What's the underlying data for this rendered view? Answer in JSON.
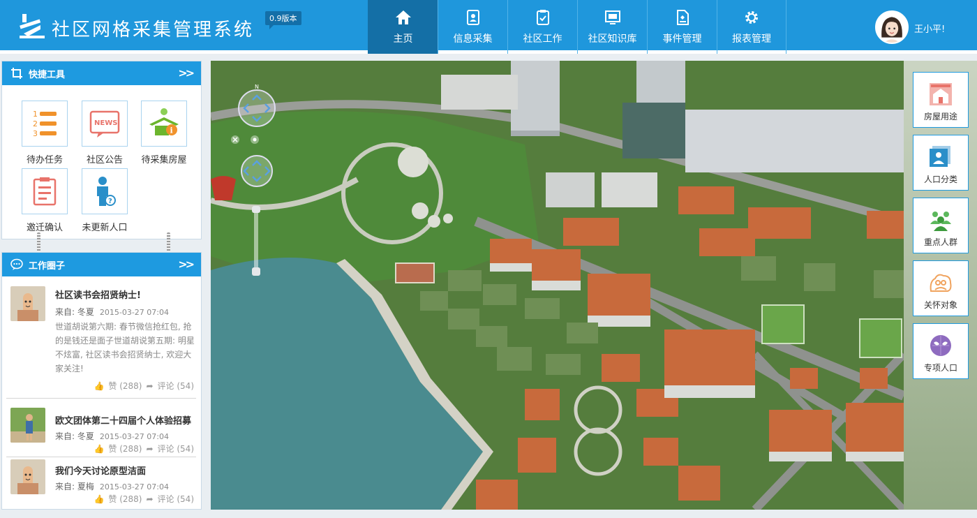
{
  "header": {
    "title": "社区网格采集管理系统",
    "version": "0.9版本",
    "user_name": "王小平!"
  },
  "nav": [
    {
      "label": "主页",
      "icon": "home-icon"
    },
    {
      "label": "信息采集",
      "icon": "collect-icon"
    },
    {
      "label": "社区工作",
      "icon": "clipboard-icon"
    },
    {
      "label": "社区知识库",
      "icon": "knowledge-icon"
    },
    {
      "label": "事件管理",
      "icon": "event-icon"
    },
    {
      "label": "报表管理",
      "icon": "gear-icon"
    }
  ],
  "quick_tools": {
    "title": "快捷工具",
    "more": ">>",
    "items": [
      {
        "label": "待办任务",
        "icon": "todo-list-icon"
      },
      {
        "label": "社区公告",
        "icon": "news-icon"
      },
      {
        "label": "待采集房屋",
        "icon": "house-info-icon"
      },
      {
        "label": "邀迁确认",
        "icon": "checklist-icon"
      },
      {
        "label": "未更新人口",
        "icon": "person-question-icon"
      }
    ]
  },
  "work_circle": {
    "title": "工作圈子",
    "more": ">>",
    "posts": [
      {
        "title": "社区读书会招贤纳士!",
        "from": "来自: 冬夏",
        "time": "2015-03-27 07:04",
        "body": "世道胡说第六期: 春节微信抢红包, 抢的是钱还是面子世道胡说第五期: 明星不炫富, 社区读书会招贤纳士, 欢迎大家关注!",
        "likes": "赞 (288)",
        "comments": "评论 (54)"
      },
      {
        "title": "欧文团体第二十四届个人体验招募",
        "from": "来自: 冬夏",
        "time": "2015-03-27 07:04",
        "likes": "赞 (288)",
        "comments": "评论 (54)"
      },
      {
        "title": "我们今天讨论原型洁面",
        "from": "来自: 夏梅",
        "time": "2015-03-27 07:04",
        "likes": "赞 (288)",
        "comments": "评论 (54)"
      }
    ]
  },
  "side_buttons": [
    {
      "label": "房屋用途",
      "icon": "house-use-icon",
      "color": "#e8736a"
    },
    {
      "label": "人口分类",
      "icon": "id-card-icon",
      "color": "#2a8fc9"
    },
    {
      "label": "重点人群",
      "icon": "group-icon",
      "color": "#5cb85c"
    },
    {
      "label": "关怀对象",
      "icon": "care-icon",
      "color": "#f0a35e"
    },
    {
      "label": "专项人口",
      "icon": "mask-icon",
      "color": "#8e6bbf"
    }
  ],
  "colors": {
    "brand": "#1f97dc",
    "nav_active": "#146fa6"
  }
}
